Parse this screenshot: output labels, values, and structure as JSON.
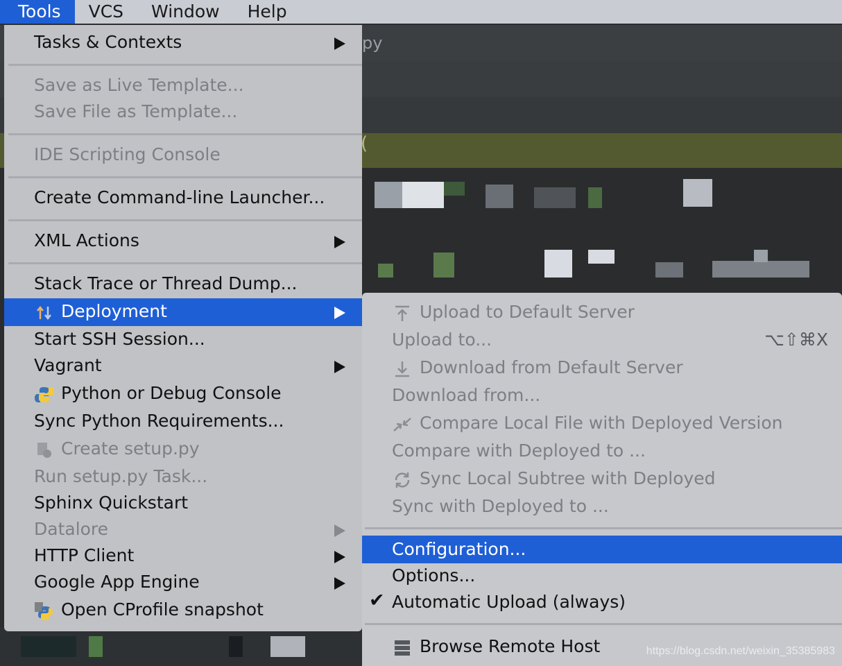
{
  "menubar": {
    "items": [
      {
        "label": "Tools",
        "active": true
      },
      {
        "label": "VCS"
      },
      {
        "label": "Window"
      },
      {
        "label": "Help"
      }
    ]
  },
  "editor": {
    "tab_fragment": "py",
    "paren": "("
  },
  "tools_menu": {
    "items": [
      {
        "label": "Tasks & Contexts",
        "submenu": true
      },
      {
        "label": "Save as Live Template...",
        "disabled": true
      },
      {
        "label": "Save File as Template...",
        "disabled": true
      },
      {
        "label": "IDE Scripting Console",
        "disabled": true
      },
      {
        "label": "Create Command-line Launcher..."
      },
      {
        "label": "XML Actions",
        "submenu": true
      },
      {
        "label": "Stack Trace or Thread Dump..."
      },
      {
        "label": "Deployment",
        "submenu": true,
        "highlighted": true,
        "icon": "deployment-arrows-icon"
      },
      {
        "label": "Start SSH Session..."
      },
      {
        "label": "Vagrant",
        "submenu": true
      },
      {
        "label": "Python or Debug Console",
        "icon": "python-icon"
      },
      {
        "label": "Sync Python Requirements..."
      },
      {
        "label": "Create setup.py",
        "disabled": true,
        "icon": "setup-py-icon"
      },
      {
        "label": "Run setup.py Task...",
        "disabled": true
      },
      {
        "label": "Sphinx Quickstart"
      },
      {
        "label": "Datalore",
        "submenu": true,
        "disabled": true
      },
      {
        "label": "HTTP Client",
        "submenu": true
      },
      {
        "label": "Google App Engine",
        "submenu": true
      },
      {
        "label": "Open CProfile snapshot",
        "icon": "cprofile-python-icon"
      }
    ]
  },
  "deployment_submenu": {
    "items": [
      {
        "label": "Upload to Default Server",
        "disabled": true,
        "icon": "upload-icon"
      },
      {
        "label": "Upload to...",
        "disabled": true,
        "shortcut": "⌥⇧⌘X"
      },
      {
        "label": "Download from Default Server",
        "disabled": true,
        "icon": "download-icon"
      },
      {
        "label": "Download from...",
        "disabled": true
      },
      {
        "label": "Compare Local File with Deployed Version",
        "disabled": true,
        "icon": "compare-icon"
      },
      {
        "label": "Compare with Deployed to ...",
        "disabled": true
      },
      {
        "label": "Sync Local Subtree with Deployed",
        "disabled": true,
        "icon": "sync-icon"
      },
      {
        "label": "Sync with Deployed to ...",
        "disabled": true
      },
      {
        "label": "Configuration...",
        "highlighted": true
      },
      {
        "label": "Options..."
      },
      {
        "label": "Automatic Upload (always)",
        "checked": true
      },
      {
        "label": "Browse Remote Host",
        "icon": "server-icon"
      }
    ],
    "check_glyph": "✔"
  },
  "watermark": "https://blog.csdn.net/weixin_35385983",
  "colors": {
    "highlight": "#1f5fd6",
    "menu_bg": "#c0c2c6",
    "disabled_text": "#7c7f84",
    "editor_bg": "#2b2c2e"
  }
}
